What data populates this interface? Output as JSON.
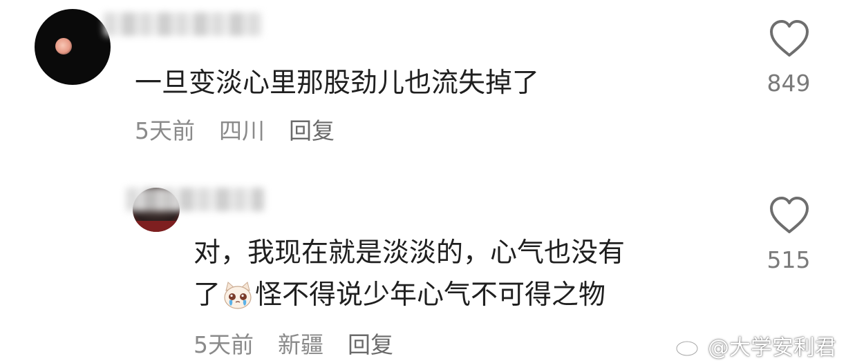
{
  "comments": [
    {
      "text": "一旦变淡心里那股劲儿也流失掉了",
      "meta": {
        "time": "5天前",
        "location": "四川",
        "reply_label": "回复"
      },
      "likes": "849"
    },
    {
      "text_line1": "对，我现在就是淡淡的，心气也没有",
      "text_line2_prefix": "了",
      "emoji": "crying-cat-emoji",
      "text_line2_suffix": "怪不得说少年心气不可得之物",
      "meta": {
        "time": "5天前",
        "location": "新疆",
        "reply_label": "回复"
      },
      "likes": "515"
    }
  ],
  "icons": {
    "like": "heart-outline-icon",
    "watermark_logo": "weibo-logo-icon"
  },
  "watermark": "@大学安利君",
  "colors": {
    "text": "#1f1f1f",
    "meta": "#8a8a8a",
    "heart": "#6e6e6e"
  }
}
